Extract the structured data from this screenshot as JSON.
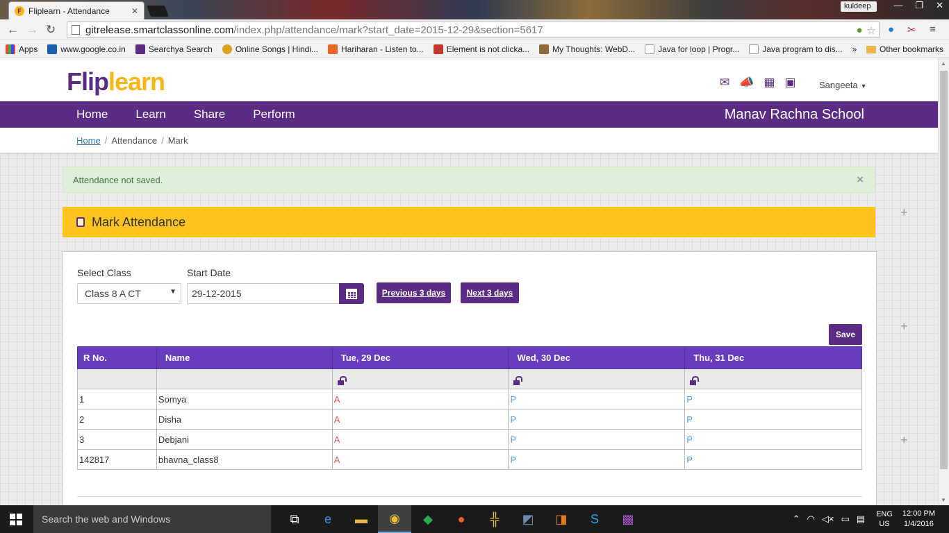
{
  "browser": {
    "tab_title": "Fliplearn - Attendance",
    "tab_favicon": "F",
    "profile_name": "kuldeep",
    "url_host": "gitrelease.smartclassonline.com",
    "url_path": "/index.php/attendance/mark?start_date=2015-12-29&section=5617",
    "bookmarks": [
      "Apps",
      "www.google.co.in",
      "Searchya Search",
      "Online Songs | Hindi...",
      "Hariharan - Listen to...",
      "Element is not clicka...",
      "My Thoughts: WebD...",
      "Java for loop | Progr...",
      "Java program to dis..."
    ],
    "overflow": "»",
    "other_bookmarks": "Other bookmarks"
  },
  "site": {
    "logo_part1": "Flip",
    "logo_part2": "learn",
    "user_name": "Sangeeta",
    "nav": [
      "Home",
      "Learn",
      "Share",
      "Perform"
    ],
    "school_name": "Manav Rachna School",
    "colors": {
      "brand_purple": "#5b2c83",
      "brand_yellow": "#fdc41e",
      "table_header": "#663dbf",
      "absent_red": "#e0544b",
      "present_blue": "#4a9fe0"
    }
  },
  "breadcrumb": {
    "home": "Home",
    "sep": "/",
    "level1": "Attendance",
    "level2": "Mark"
  },
  "alert": {
    "message": "Attendance not saved.",
    "close": "×"
  },
  "panel": {
    "title": "Mark Attendance",
    "select_class_label": "Select Class",
    "selected_class": "Class 8 A CT",
    "start_date_label": "Start Date",
    "start_date_value": "29-12-2015",
    "prev_btn": "Previous 3 days",
    "next_btn": "Next 3 days",
    "save_btn": "Save"
  },
  "table": {
    "headers": [
      "R No.",
      "Name",
      "Tue, 29 Dec",
      "Wed, 30 Dec",
      "Thu, 31 Dec"
    ],
    "rows": [
      {
        "rno": "1",
        "name": "Somya",
        "d1": "A",
        "d2": "P",
        "d3": "P"
      },
      {
        "rno": "2",
        "name": "Disha",
        "d1": "A",
        "d2": "P",
        "d3": "P"
      },
      {
        "rno": "3",
        "name": "Debjani",
        "d1": "A",
        "d2": "P",
        "d3": "P"
      },
      {
        "rno": "142817",
        "name": "bhavna_class8",
        "d1": "A",
        "d2": "P",
        "d3": "P"
      }
    ]
  },
  "taskbar": {
    "search_placeholder": "Search the web and Windows",
    "lang1": "ENG",
    "lang2": "US",
    "time": "12:00 PM",
    "date": "1/4/2016"
  }
}
